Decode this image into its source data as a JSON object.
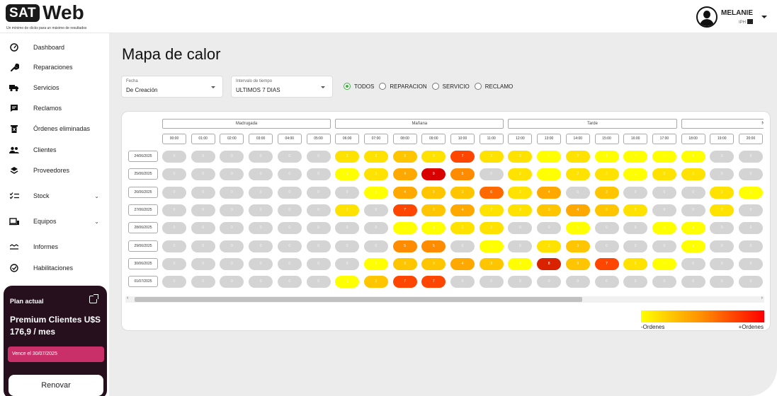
{
  "header": {
    "logo_sat": "SAT",
    "logo_web": "Web",
    "tagline": "Un mínimo de clicks para un máximo de resultados",
    "user_name": "MELANIE",
    "user_role": "IPH"
  },
  "sidebar": {
    "items": [
      {
        "label": "Dashboard",
        "icon": "gauge-icon"
      },
      {
        "label": "Reparaciones",
        "icon": "wrench-icon"
      },
      {
        "label": "Servicios",
        "icon": "truck-icon"
      },
      {
        "label": "Reclamos",
        "icon": "chat-icon"
      },
      {
        "label": "Órdenes eliminadas",
        "icon": "trash-icon"
      },
      {
        "label": "Clientes",
        "icon": "people-icon"
      },
      {
        "label": "Proveedores",
        "icon": "layers-icon"
      },
      {
        "label": "Stock",
        "icon": "checklist-icon"
      },
      {
        "label": "Equipos",
        "icon": "devices-icon"
      },
      {
        "label": "Informes",
        "icon": "trend-icon"
      },
      {
        "label": "Habilitaciones",
        "icon": "check-circle-icon"
      }
    ],
    "plan": {
      "title": "Plan actual",
      "name": "Premium Clientes U$S 176,9 / mes",
      "expires": "Vence el 30/07/2025",
      "renew_label": "Renovar"
    }
  },
  "main": {
    "title": "Mapa de calor",
    "filters": {
      "fecha_label": "Fecha",
      "fecha_value": "De Creación",
      "intervalo_label": "Intervalo de tiempo",
      "intervalo_value": "ULTIMOS 7 DIAS",
      "radios": [
        "TODOS",
        "REPARACION",
        "SERVICIO",
        "RECLAMO"
      ],
      "selected_radio": "TODOS"
    },
    "heatmap": {
      "periods": [
        "Madrugada",
        "Mañana",
        "Tarde",
        "Noc"
      ],
      "hours": [
        "00:00",
        "01:00",
        "02:00",
        "03:00",
        "04:00",
        "05:00",
        "06:00",
        "07:00",
        "08:00",
        "09:00",
        "10:00",
        "11:00",
        "12:00",
        "13:00",
        "14:00",
        "15:00",
        "16:00",
        "17:00",
        "18:00",
        "19:00",
        "20:00"
      ],
      "dates": [
        "24/06/2025",
        "25/06/2025",
        "26/06/2025",
        "27/06/2025",
        "28/06/2025",
        "29/06/2025",
        "30/06/2025",
        "01/07/2025"
      ],
      "values": [
        [
          0,
          0,
          0,
          0,
          0,
          0,
          2,
          2,
          3,
          2,
          7,
          2,
          2,
          1,
          2,
          1,
          1,
          1,
          1,
          0,
          0
        ],
        [
          0,
          0,
          0,
          0,
          0,
          0,
          1,
          2,
          4,
          9,
          5,
          0,
          2,
          1,
          2,
          2,
          1,
          2,
          2,
          0,
          0
        ],
        [
          0,
          0,
          0,
          0,
          0,
          0,
          0,
          1,
          4,
          3,
          3,
          6,
          2,
          4,
          0,
          3,
          0,
          0,
          0,
          2,
          1
        ],
        [
          0,
          0,
          0,
          0,
          0,
          0,
          2,
          0,
          7,
          3,
          4,
          2,
          2,
          3,
          4,
          3,
          2,
          0,
          0,
          2,
          0
        ],
        [
          0,
          0,
          0,
          0,
          0,
          0,
          0,
          0,
          1,
          1,
          2,
          2,
          0,
          0,
          1,
          0,
          0,
          1,
          1,
          0,
          0
        ],
        [
          0,
          0,
          0,
          0,
          0,
          0,
          0,
          0,
          5,
          5,
          0,
          1,
          0,
          2,
          3,
          0,
          0,
          0,
          1,
          0,
          0
        ],
        [
          0,
          0,
          0,
          0,
          0,
          0,
          0,
          1,
          3,
          3,
          4,
          3,
          1,
          8,
          3,
          7,
          2,
          1,
          0,
          0,
          0
        ],
        [
          0,
          0,
          0,
          0,
          0,
          0,
          1,
          3,
          7,
          7,
          0,
          0,
          0,
          0,
          0,
          0,
          0,
          0,
          0,
          0,
          0
        ]
      ],
      "legend_min": "-Ordenes",
      "legend_max": "+Ordenes",
      "colors": {
        "zero": "#d4d4d4",
        "low": "#ffff00",
        "mid": "#ff8c00",
        "high": "#ff0000"
      }
    }
  }
}
